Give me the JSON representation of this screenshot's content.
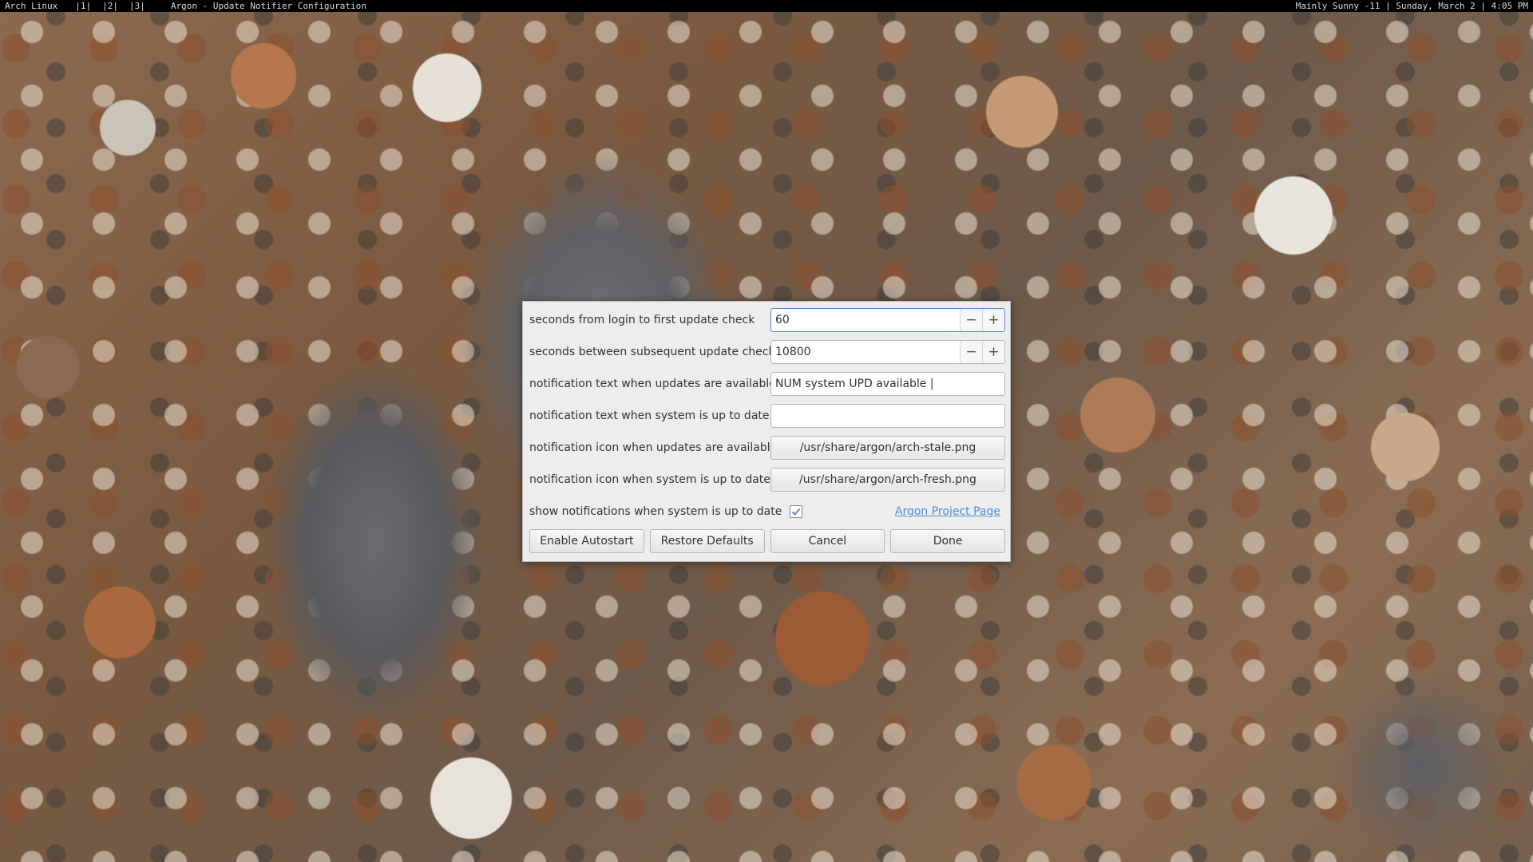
{
  "topbar": {
    "distro": "Arch Linux",
    "workspaces": [
      "|1|",
      "|2|",
      "|3|"
    ],
    "window_title": "Argon - Update Notifier Configuration",
    "status": "Mainly Sunny -11 | Sunday, March 2 | 4:05 PM"
  },
  "dialog": {
    "first_check": {
      "label": "seconds from login to first update check",
      "value": "60"
    },
    "interval": {
      "label": "seconds between subsequent update checks",
      "value": "10800"
    },
    "text_updates": {
      "label": "notification text when updates are available",
      "value": "NUM system UPD available |"
    },
    "text_uptodate": {
      "label": "notification text when system is up to date",
      "value": ""
    },
    "icon_updates": {
      "label": "notification icon when updates are available",
      "value": "/usr/share/argon/arch-stale.png"
    },
    "icon_uptodate": {
      "label": "notification icon when system is up to date",
      "value": "/usr/share/argon/arch-fresh.png"
    },
    "show_uptodate": {
      "label": "show notifications when system is up to date",
      "checked": true
    },
    "project_link": "Argon Project Page",
    "spin_minus": "−",
    "spin_plus": "+",
    "buttons": {
      "autostart": "Enable Autostart",
      "restore": "Restore Defaults",
      "cancel": "Cancel",
      "done": "Done"
    }
  },
  "colors": {
    "accent": "#4a90d9",
    "dialog_bg": "#ededed",
    "topbar_bg": "#000000"
  }
}
